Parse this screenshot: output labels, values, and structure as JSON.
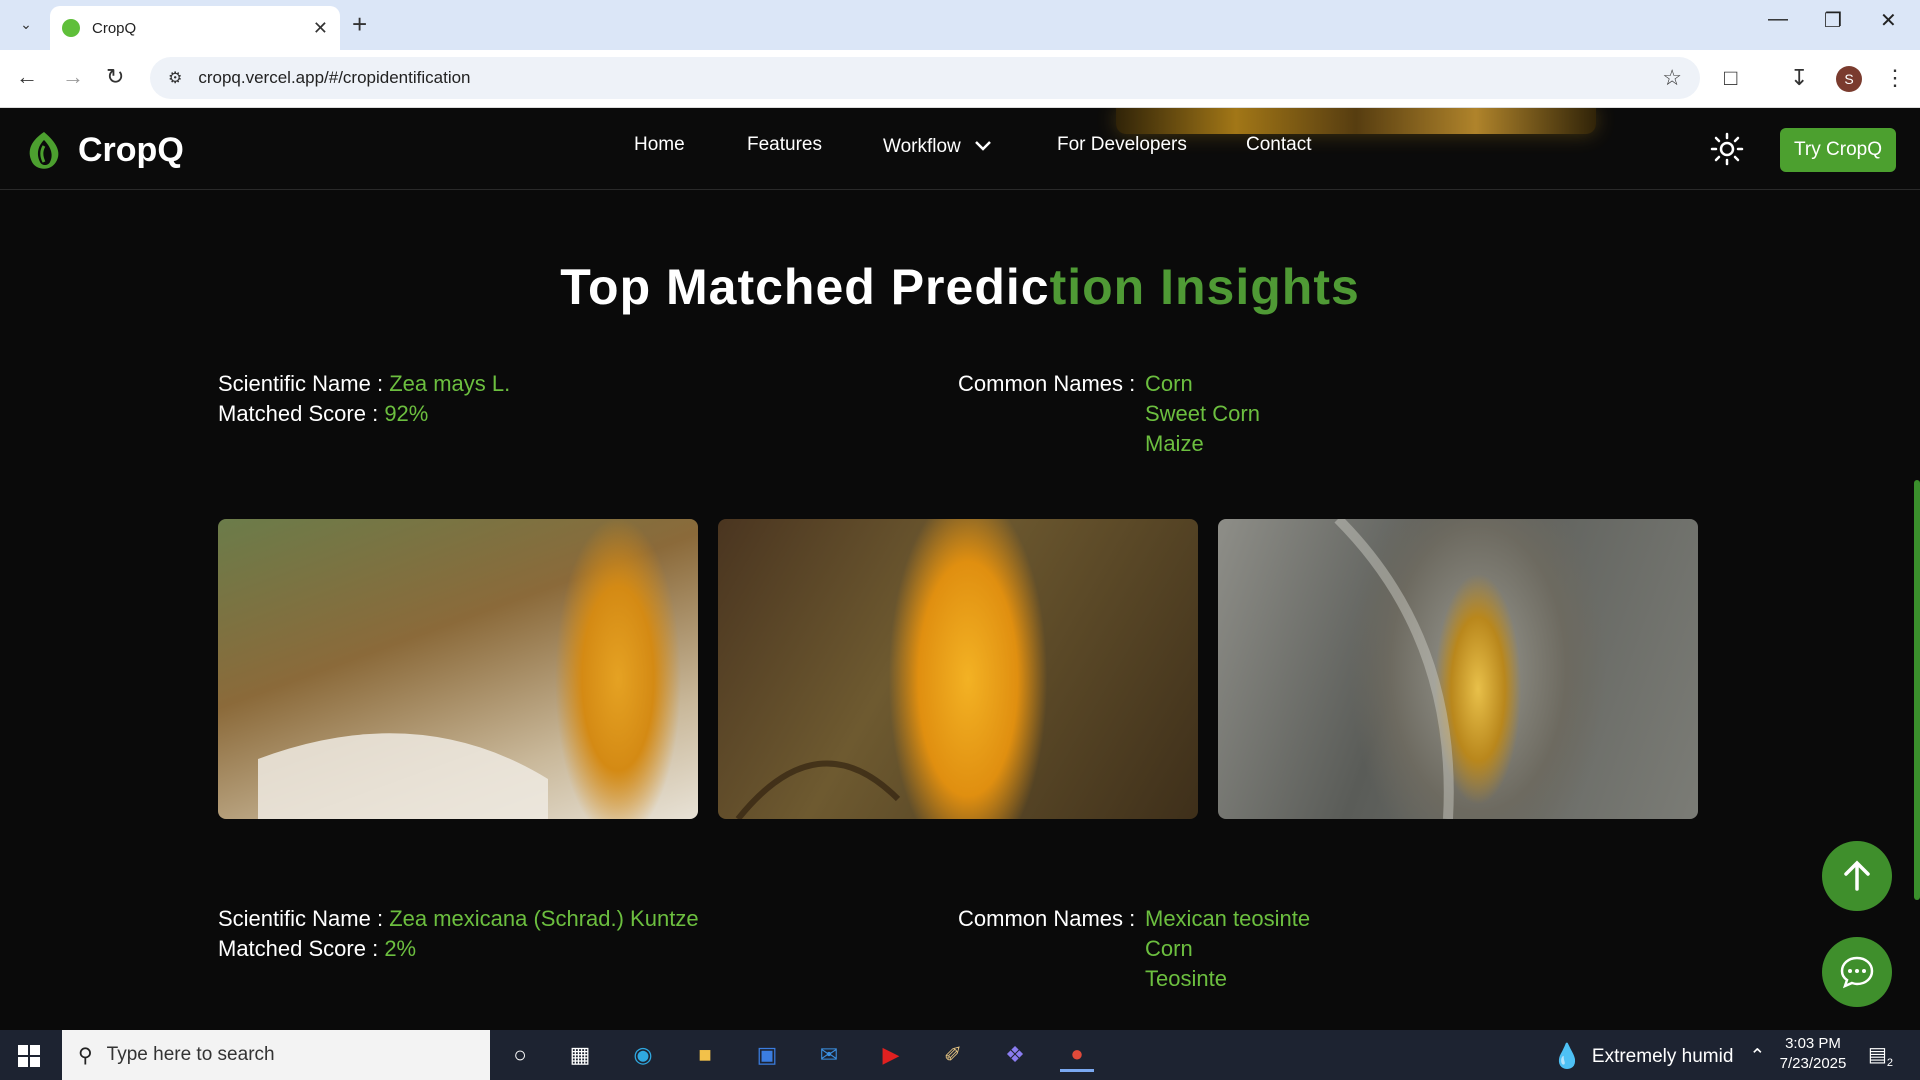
{
  "browser": {
    "tab_title": "CropQ",
    "url": "cropq.vercel.app/#/cropidentification",
    "profile_initial": "S"
  },
  "site": {
    "brand": "CropQ",
    "nav": {
      "home": "Home",
      "features": "Features",
      "workflow": "Workflow",
      "developers": "For Developers",
      "contact": "Contact"
    },
    "cta": "Try CropQ",
    "title_white": "Top Matched Predic",
    "title_green": "tion Insights",
    "labels": {
      "scientific": "Scientific Name :",
      "score": "Matched Score :",
      "common": "Common Names :"
    },
    "results": [
      {
        "scientific_name": "Zea mays L.",
        "score": "92%",
        "common_names": [
          "Corn",
          "Sweet Corn",
          "Maize"
        ]
      },
      {
        "scientific_name": "Zea mexicana (Schrad.) Kuntze",
        "score": "2%",
        "common_names": [
          "Mexican teosinte",
          "Corn",
          "Teosinte"
        ]
      }
    ],
    "colors": {
      "accent": "#4ca02f",
      "text_green": "#6cbf3f"
    }
  },
  "taskbar": {
    "search_placeholder": "Type here to search",
    "weather": "Extremely humid",
    "time": "3:03 PM",
    "date": "7/23/2025",
    "notifications": "2"
  }
}
